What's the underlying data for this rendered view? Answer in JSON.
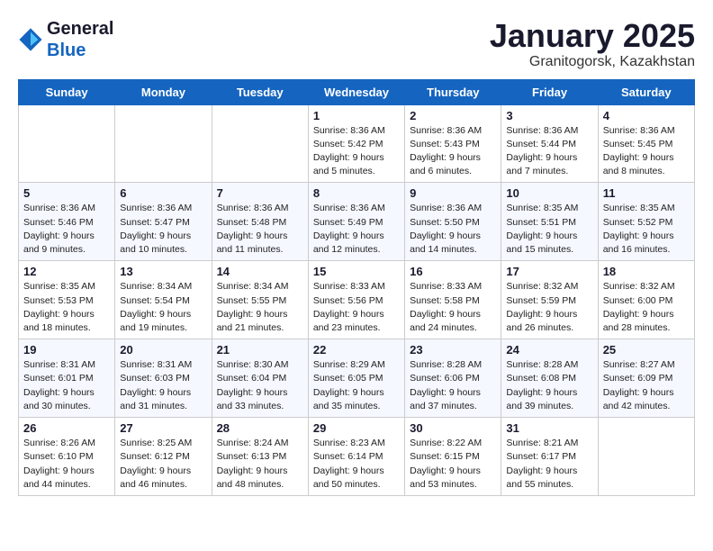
{
  "header": {
    "logo_line1": "General",
    "logo_line2": "Blue",
    "month_title": "January 2025",
    "location": "Granitogorsk, Kazakhstan"
  },
  "weekdays": [
    "Sunday",
    "Monday",
    "Tuesday",
    "Wednesday",
    "Thursday",
    "Friday",
    "Saturday"
  ],
  "weeks": [
    [
      {
        "day": "",
        "detail": ""
      },
      {
        "day": "",
        "detail": ""
      },
      {
        "day": "",
        "detail": ""
      },
      {
        "day": "1",
        "detail": "Sunrise: 8:36 AM\nSunset: 5:42 PM\nDaylight: 9 hours\nand 5 minutes."
      },
      {
        "day": "2",
        "detail": "Sunrise: 8:36 AM\nSunset: 5:43 PM\nDaylight: 9 hours\nand 6 minutes."
      },
      {
        "day": "3",
        "detail": "Sunrise: 8:36 AM\nSunset: 5:44 PM\nDaylight: 9 hours\nand 7 minutes."
      },
      {
        "day": "4",
        "detail": "Sunrise: 8:36 AM\nSunset: 5:45 PM\nDaylight: 9 hours\nand 8 minutes."
      }
    ],
    [
      {
        "day": "5",
        "detail": "Sunrise: 8:36 AM\nSunset: 5:46 PM\nDaylight: 9 hours\nand 9 minutes."
      },
      {
        "day": "6",
        "detail": "Sunrise: 8:36 AM\nSunset: 5:47 PM\nDaylight: 9 hours\nand 10 minutes."
      },
      {
        "day": "7",
        "detail": "Sunrise: 8:36 AM\nSunset: 5:48 PM\nDaylight: 9 hours\nand 11 minutes."
      },
      {
        "day": "8",
        "detail": "Sunrise: 8:36 AM\nSunset: 5:49 PM\nDaylight: 9 hours\nand 12 minutes."
      },
      {
        "day": "9",
        "detail": "Sunrise: 8:36 AM\nSunset: 5:50 PM\nDaylight: 9 hours\nand 14 minutes."
      },
      {
        "day": "10",
        "detail": "Sunrise: 8:35 AM\nSunset: 5:51 PM\nDaylight: 9 hours\nand 15 minutes."
      },
      {
        "day": "11",
        "detail": "Sunrise: 8:35 AM\nSunset: 5:52 PM\nDaylight: 9 hours\nand 16 minutes."
      }
    ],
    [
      {
        "day": "12",
        "detail": "Sunrise: 8:35 AM\nSunset: 5:53 PM\nDaylight: 9 hours\nand 18 minutes."
      },
      {
        "day": "13",
        "detail": "Sunrise: 8:34 AM\nSunset: 5:54 PM\nDaylight: 9 hours\nand 19 minutes."
      },
      {
        "day": "14",
        "detail": "Sunrise: 8:34 AM\nSunset: 5:55 PM\nDaylight: 9 hours\nand 21 minutes."
      },
      {
        "day": "15",
        "detail": "Sunrise: 8:33 AM\nSunset: 5:56 PM\nDaylight: 9 hours\nand 23 minutes."
      },
      {
        "day": "16",
        "detail": "Sunrise: 8:33 AM\nSunset: 5:58 PM\nDaylight: 9 hours\nand 24 minutes."
      },
      {
        "day": "17",
        "detail": "Sunrise: 8:32 AM\nSunset: 5:59 PM\nDaylight: 9 hours\nand 26 minutes."
      },
      {
        "day": "18",
        "detail": "Sunrise: 8:32 AM\nSunset: 6:00 PM\nDaylight: 9 hours\nand 28 minutes."
      }
    ],
    [
      {
        "day": "19",
        "detail": "Sunrise: 8:31 AM\nSunset: 6:01 PM\nDaylight: 9 hours\nand 30 minutes."
      },
      {
        "day": "20",
        "detail": "Sunrise: 8:31 AM\nSunset: 6:03 PM\nDaylight: 9 hours\nand 31 minutes."
      },
      {
        "day": "21",
        "detail": "Sunrise: 8:30 AM\nSunset: 6:04 PM\nDaylight: 9 hours\nand 33 minutes."
      },
      {
        "day": "22",
        "detail": "Sunrise: 8:29 AM\nSunset: 6:05 PM\nDaylight: 9 hours\nand 35 minutes."
      },
      {
        "day": "23",
        "detail": "Sunrise: 8:28 AM\nSunset: 6:06 PM\nDaylight: 9 hours\nand 37 minutes."
      },
      {
        "day": "24",
        "detail": "Sunrise: 8:28 AM\nSunset: 6:08 PM\nDaylight: 9 hours\nand 39 minutes."
      },
      {
        "day": "25",
        "detail": "Sunrise: 8:27 AM\nSunset: 6:09 PM\nDaylight: 9 hours\nand 42 minutes."
      }
    ],
    [
      {
        "day": "26",
        "detail": "Sunrise: 8:26 AM\nSunset: 6:10 PM\nDaylight: 9 hours\nand 44 minutes."
      },
      {
        "day": "27",
        "detail": "Sunrise: 8:25 AM\nSunset: 6:12 PM\nDaylight: 9 hours\nand 46 minutes."
      },
      {
        "day": "28",
        "detail": "Sunrise: 8:24 AM\nSunset: 6:13 PM\nDaylight: 9 hours\nand 48 minutes."
      },
      {
        "day": "29",
        "detail": "Sunrise: 8:23 AM\nSunset: 6:14 PM\nDaylight: 9 hours\nand 50 minutes."
      },
      {
        "day": "30",
        "detail": "Sunrise: 8:22 AM\nSunset: 6:15 PM\nDaylight: 9 hours\nand 53 minutes."
      },
      {
        "day": "31",
        "detail": "Sunrise: 8:21 AM\nSunset: 6:17 PM\nDaylight: 9 hours\nand 55 minutes."
      },
      {
        "day": "",
        "detail": ""
      }
    ]
  ]
}
